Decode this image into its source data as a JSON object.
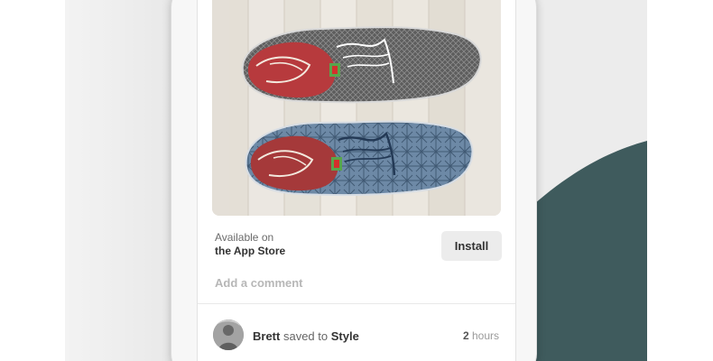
{
  "pin": {
    "product_image_alt": "",
    "app": {
      "available_label": "Available on",
      "store_name": "the App Store",
      "install_label": "Install"
    },
    "comment_placeholder": "Add a comment",
    "activity": {
      "user": "Brett",
      "action": "saved to",
      "board": "Style",
      "time_value": "2",
      "time_unit": "hours"
    }
  },
  "colors": {
    "teal_accent": "#3f5b5d",
    "install_button_bg": "#ececec"
  }
}
